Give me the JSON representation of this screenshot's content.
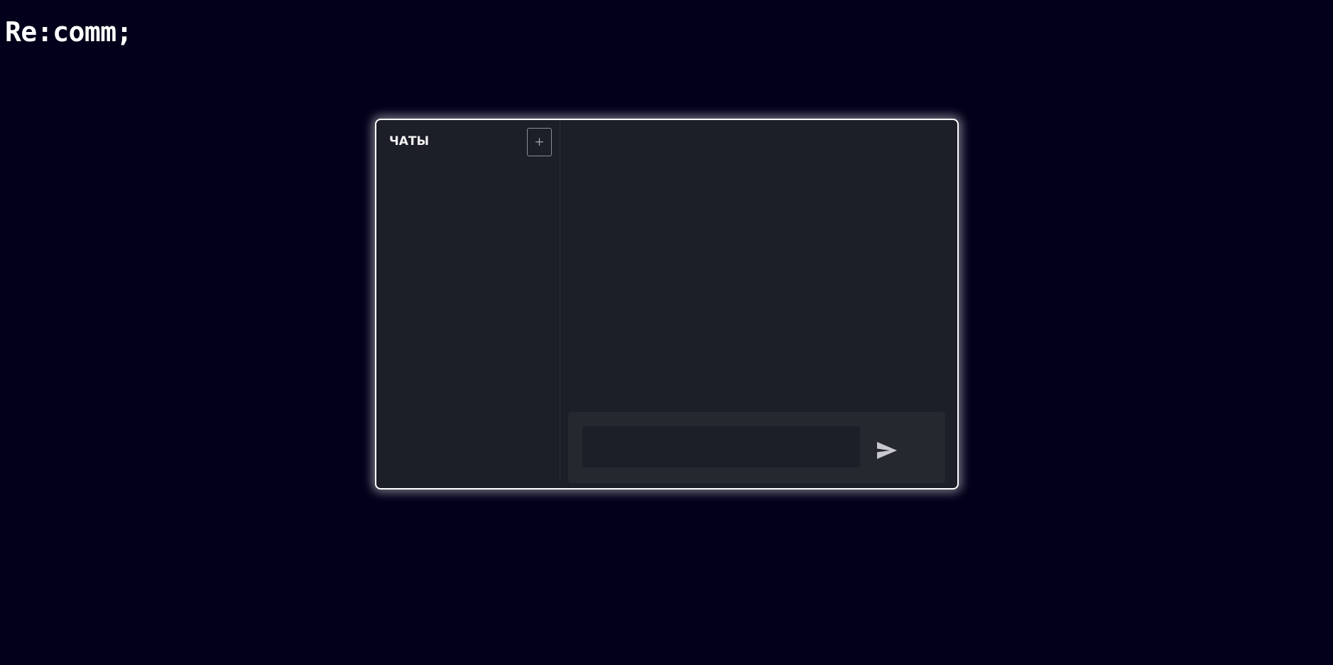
{
  "app": {
    "brand": "Re:comm;"
  },
  "sidebar": {
    "title": "ЧАТЫ",
    "new_chat_label": "+",
    "chats": []
  },
  "composer": {
    "input_value": "",
    "input_placeholder": "",
    "send_icon": "send-icon"
  },
  "colors": {
    "page_background": "#02001a",
    "panel_background": "#1c1e28",
    "composer_background": "#262830",
    "panel_border": "#ffffff",
    "send_icon": "#c8c9ce"
  }
}
